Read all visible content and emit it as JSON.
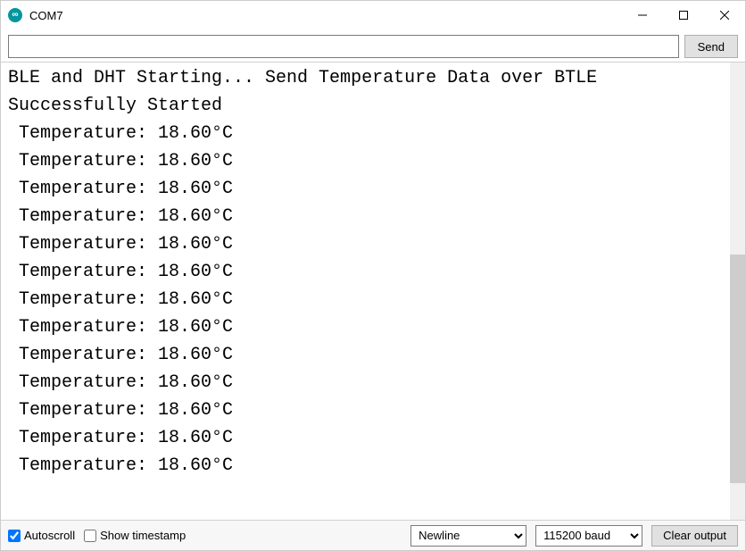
{
  "window": {
    "title": "COM7"
  },
  "input_row": {
    "command_value": "",
    "send_label": "Send"
  },
  "output": {
    "lines": [
      "BLE and DHT Starting... Send Temperature Data over BTLE",
      "Successfully Started",
      " Temperature: 18.60°C",
      " Temperature: 18.60°C",
      " Temperature: 18.60°C",
      " Temperature: 18.60°C",
      " Temperature: 18.60°C",
      " Temperature: 18.60°C",
      " Temperature: 18.60°C",
      " Temperature: 18.60°C",
      " Temperature: 18.60°C",
      " Temperature: 18.60°C",
      " Temperature: 18.60°C",
      " Temperature: 18.60°C",
      " Temperature: 18.60°C"
    ]
  },
  "bottom_bar": {
    "autoscroll_label": "Autoscroll",
    "autoscroll_checked": true,
    "timestamp_label": "Show timestamp",
    "timestamp_checked": false,
    "line_ending_selected": "Newline",
    "baud_selected": "115200 baud",
    "clear_label": "Clear output"
  }
}
